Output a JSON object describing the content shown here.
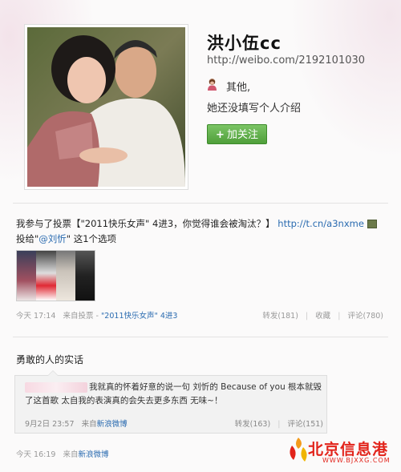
{
  "profile": {
    "username": "洪小伍cc",
    "weibo_url": "http://weibo.com/2192101030",
    "gender_icon": "female-user-icon",
    "gender_text": "其他,",
    "bio": "她还没填写个人介绍",
    "follow_label": "加关注",
    "follow_icon": "plus-icon"
  },
  "post1": {
    "text_before": "我参与了投票【\"2011快乐女声\" 4进3，你觉得谁会被淘汰？】",
    "link": "http://t.cn/a3nxme",
    "text_after": " 投给\"",
    "mention": "@刘忻",
    "text_end": "\" 这1个选项",
    "time": "今天 17:14",
    "source_prefix": "来自投票 - ",
    "source": "\"2011快乐女声\" 4进3",
    "repost": "转发(181)",
    "favorite": "收藏",
    "comment": "评论(780)"
  },
  "section2": {
    "title": "勇敢的人的实话",
    "repost_text": "我就真的怀着好意的说一句 刘忻的 Because of you 根本就毁了这首歌 太自我的表演真的会失去更多东西 无味~！",
    "repost_time": "9月2日 23:57",
    "repost_source_prefix": "来自",
    "repost_source": "新浪微博",
    "repost_repost": "转发(163)",
    "repost_comment": "评论(151)",
    "post_time": "今天 16:19",
    "post_source_prefix": "来自",
    "post_source": "新浪微博"
  },
  "watermark": {
    "name": "北京信息港",
    "domain": "WWW.BJXXG.COM"
  },
  "colors": {
    "follow_green": "#5aa846",
    "link_blue": "#2a6bb0",
    "watermark_red": "#e2231a"
  }
}
